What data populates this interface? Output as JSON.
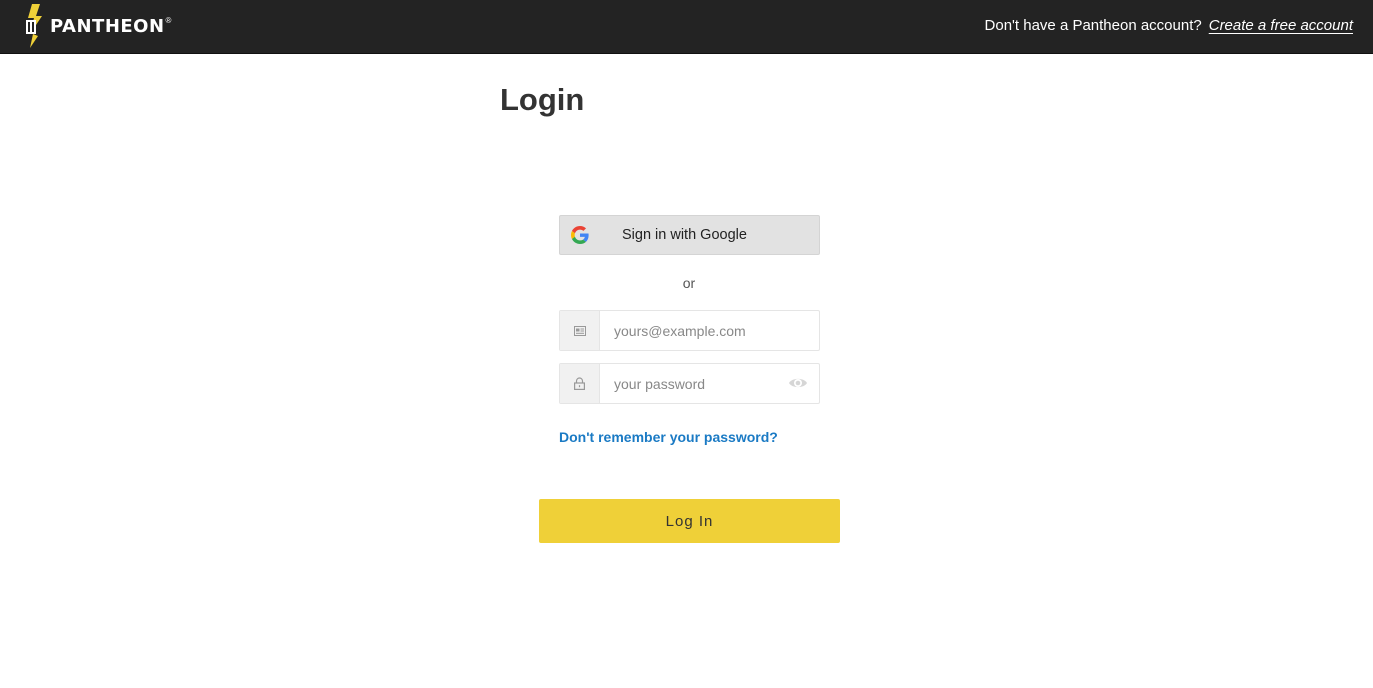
{
  "header": {
    "brand": "PANTHEON",
    "brand_mark": "®",
    "signup_prompt": "Don't have a Pantheon account?",
    "signup_link": "Create a free account"
  },
  "main": {
    "title": "Login",
    "google_button_label": "Sign in with Google",
    "divider_text": "or",
    "email": {
      "placeholder": "yours@example.com",
      "value": "",
      "icon": "email-card-icon"
    },
    "password": {
      "placeholder": "your password",
      "value": "",
      "icon": "lock-icon",
      "toggle_icon": "eye-icon"
    },
    "forgot_password_link": "Don't remember your password?",
    "login_button_label": "Log In"
  },
  "colors": {
    "header_bg": "#232323",
    "accent_yellow": "#efd038",
    "link_blue": "#1a7ac4",
    "google_button_bg": "#e2e2e2"
  }
}
